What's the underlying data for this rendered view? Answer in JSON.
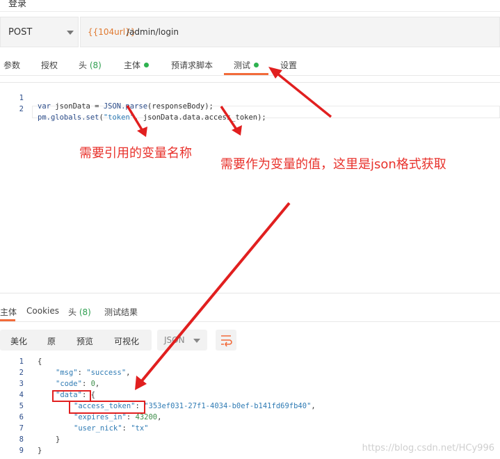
{
  "top": {
    "title_fragment": "登录"
  },
  "request": {
    "method": "POST",
    "url_var": "{{104url}}",
    "url_path": "/admin/login"
  },
  "tabs": [
    {
      "label": "参数"
    },
    {
      "label": "授权"
    },
    {
      "label": "头",
      "count": "(8)"
    },
    {
      "label": "主体"
    },
    {
      "label": "预请求脚本"
    },
    {
      "label": "测试"
    },
    {
      "label": "设置"
    }
  ],
  "script": {
    "lines": [
      {
        "n": "1",
        "t1": "var",
        "t2": " jsonData = ",
        "t3": "JSON.parse",
        "t4": "(responseBody);"
      },
      {
        "n": "2",
        "t1": "pm.globals.set",
        "t2": "(",
        "t3": "\"token\"",
        "t4": ", jsonData.data.access_token);"
      }
    ]
  },
  "annotations": {
    "a1": "需要引用的变量名称",
    "a2": "需要作为变量的值，这里是json格式获取"
  },
  "response_tabs": [
    {
      "label": "主体"
    },
    {
      "label": "Cookies"
    },
    {
      "label": "头",
      "count": "(8)"
    },
    {
      "label": "测试结果"
    }
  ],
  "format_bar": {
    "pretty": "美化",
    "raw": "原",
    "preview": "预览",
    "visualize": "可视化",
    "language": "JSON"
  },
  "response_body": {
    "l1": "{",
    "msg_key": "\"msg\"",
    "msg_val": "\"success\"",
    "code_key": "\"code\"",
    "code_val": "0",
    "data_key": "\"data\"",
    "token_key": "\"access_token\"",
    "token_val": "\"353ef031-27f1-4034-b0ef-b141fd69fb40\"",
    "exp_key": "\"expires_in\"",
    "exp_val": "43200",
    "nick_key": "\"user_nick\"",
    "nick_val": "\"tx\"",
    "l8": "}",
    "l9": "}"
  },
  "watermark": "https://blog.csdn.net/HCy996",
  "colors": {
    "accent": "#f26b3a",
    "annotation": "#e8322c",
    "success_dot": "#2eb24f"
  }
}
